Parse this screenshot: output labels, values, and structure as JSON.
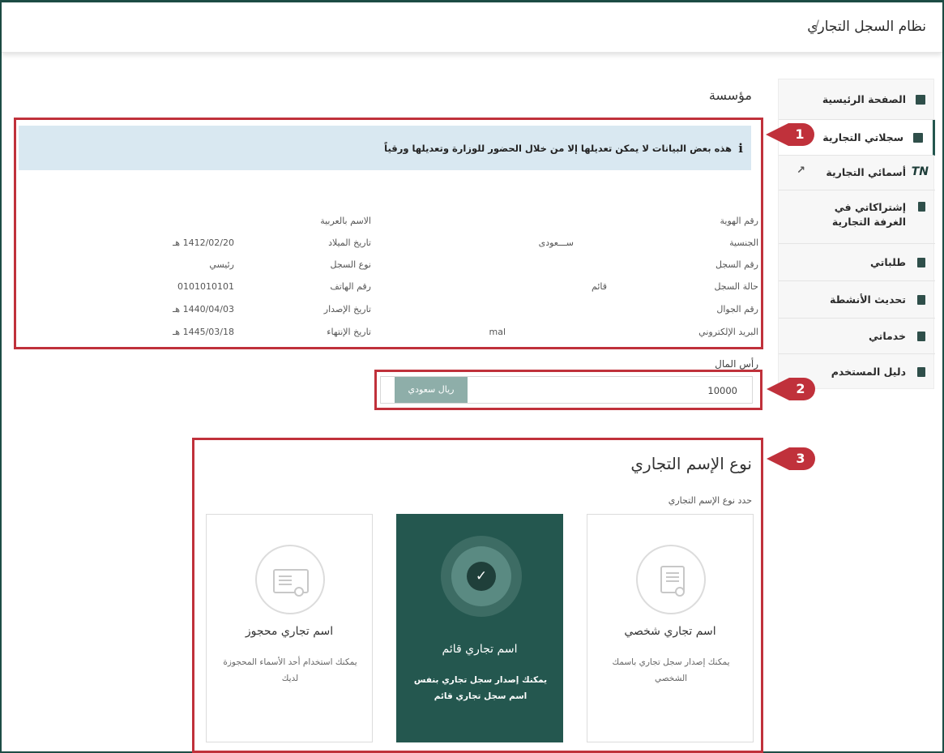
{
  "header": {
    "title": "نظام السجل التجاري",
    "separator": "/"
  },
  "sidebar": {
    "items": [
      {
        "label": "الصفحة الرئيسية",
        "icon": "dashboard-icon"
      },
      {
        "label": "سجلاتي التجارية",
        "icon": "briefcase-icon",
        "active": true
      },
      {
        "label": "أسمائي التجارية",
        "icon": "tn-icon",
        "icon_text": "TN",
        "external": true
      },
      {
        "label": "إشتراكاتي في الغرفة التجارية",
        "icon": "bookmark-icon"
      },
      {
        "label": "طلباتي",
        "icon": "document-icon"
      },
      {
        "label": "تحديث الأنشطة",
        "icon": "document-icon"
      },
      {
        "label": "خدماتي",
        "icon": "document-icon"
      },
      {
        "label": "دليل المستخدم",
        "icon": "document-icon"
      }
    ]
  },
  "main": {
    "heading": "مؤسسة",
    "notice": {
      "icon_text": "i",
      "text": "هذه بعض البيانات لا يمكن تعديلها إلا من خلال الحضور للوزارة وتعديلها ورقياً"
    },
    "fields": {
      "id_number": {
        "label": "رقم الهوية",
        "value": ""
      },
      "arabic_name": {
        "label": "الاسم بالعربية",
        "value": ""
      },
      "nationality": {
        "label": "الجنسية",
        "value": "ســـعودى"
      },
      "birth_date": {
        "label": "تاريخ الميلاد",
        "value": "1412/02/20 هـ"
      },
      "register_number": {
        "label": "رقم السجل",
        "value": ""
      },
      "register_type": {
        "label": "نوع السجل",
        "value": "رئيسي"
      },
      "register_status": {
        "label": "حالة السجل",
        "value": "قائم"
      },
      "phone": {
        "label": "رقم الهاتف",
        "value": "0101010101"
      },
      "mobile": {
        "label": "رقم الجوال",
        "value": ""
      },
      "issue_date": {
        "label": "تاريخ الإصدار",
        "value": "1440/04/03 هـ"
      },
      "email": {
        "label": "البريد الإلكتروني",
        "value": "mal"
      },
      "expiry_date": {
        "label": "تاريخ الإنتهاء",
        "value": "1445/03/18 هـ"
      }
    },
    "capital": {
      "label": "رأس المال",
      "value": "10000",
      "currency": "ريال سعودي"
    },
    "trade_name_type": {
      "title": "نوع الإسم التجاري",
      "subtitle": "حدد نوع الإسم التجاري",
      "options": [
        {
          "title": "اسم تجاري شخصي",
          "description": "يمكنك إصدار سجل تجاري باسمك الشخصي",
          "selected": false
        },
        {
          "title": "اسم تجاري قائم",
          "description": "يمكنك إصدار سجل تجاري بنفس اسم سجل تجاري قائم",
          "selected": true
        },
        {
          "title": "اسم تجاري محجوز",
          "description": "يمكنك استخدام أحد الأسماء المحجوزة لديك",
          "selected": false
        }
      ],
      "check_icon": "✓"
    }
  },
  "annotations": [
    "1",
    "2",
    "3"
  ],
  "colors": {
    "accent": "#24574f",
    "annotation": "#c0313b",
    "notice_bg": "#d9e8f1"
  }
}
